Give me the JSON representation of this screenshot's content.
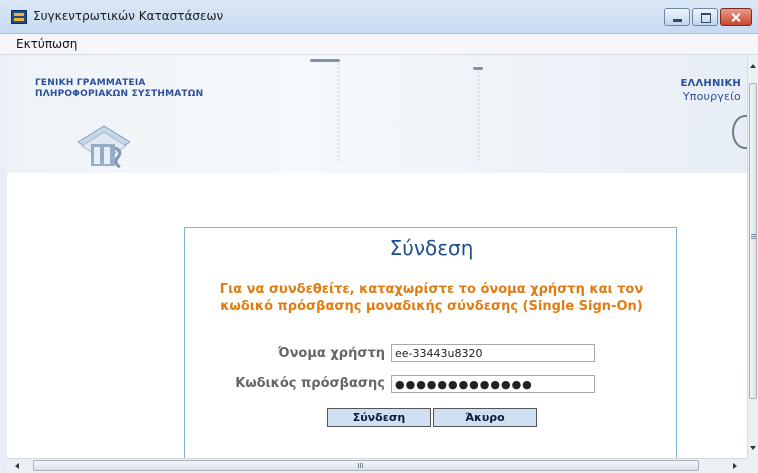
{
  "window": {
    "title": "Συγκεντρωτικών Καταστάσεων",
    "menu": [
      "Εκτύπωση"
    ]
  },
  "banner": {
    "org_line1": "ΓΕΝΙΚΗ ΓΡΑΜΜΑΤΕΙΑ",
    "org_line2": "ΠΛΗΡΟΦΟΡΙΑΚΩΝ ΣΥΣΤΗΜΑΤΩΝ",
    "right_line1": "ΕΛΛΗΝΙΚΗ",
    "right_line2": "Υπουργείο"
  },
  "login": {
    "title": "Σύνδεση",
    "message": "Για να συνδεθείτε, καταχωρίστε το όνομα χρήστη και τον κωδικό πρόσβασης μοναδικής σύνδεσης (Single Sign-On)",
    "username_label": "Όνομα χρήστη",
    "username_value": "ee-33443u8320",
    "password_label": "Κωδικός πρόσβασης",
    "password_value": "●●●●●●●●●●●●●",
    "login_button": "Σύνδεση",
    "cancel_button": "Άκυρο"
  },
  "colors": {
    "accent": "#1f4e8c",
    "message": "#e07c11",
    "border": "#7fb3d6"
  }
}
